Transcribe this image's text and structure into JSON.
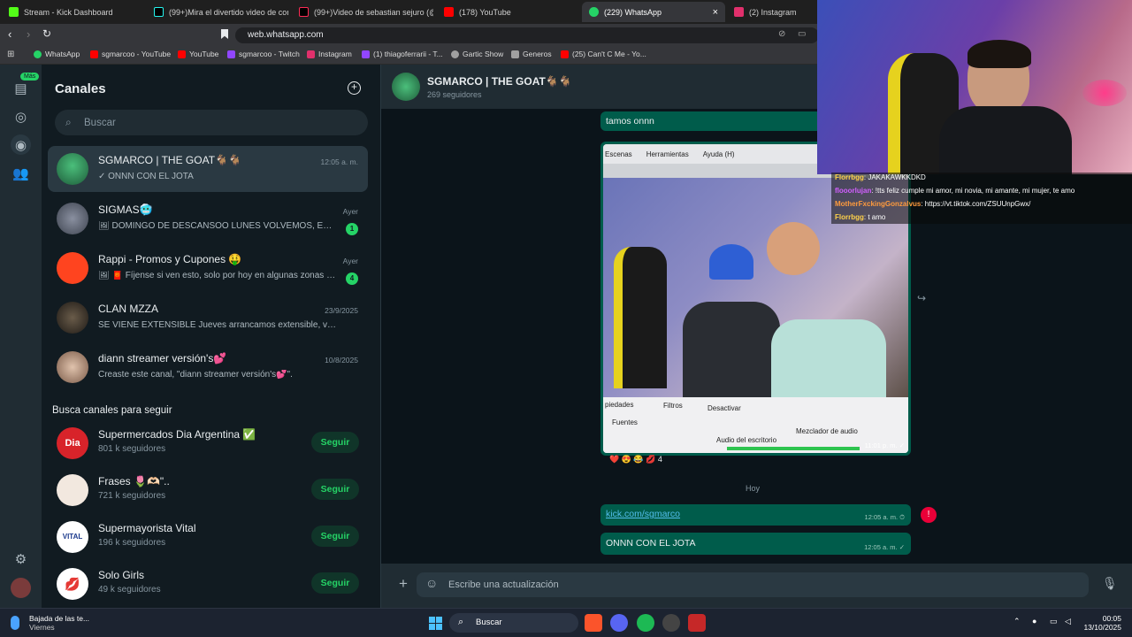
{
  "browser": {
    "tabs": [
      {
        "label": "Stream - Kick Dashboard",
        "icon": "kick-icon",
        "color": "#53fc18"
      },
      {
        "label": "(99+)Mira el divertido video de com",
        "icon": "tiktok-icon",
        "color": "#ffffff"
      },
      {
        "label": "(99+)Video de sebastian sejuro (@se",
        "icon": "tiktok-icon",
        "color": "#ffffff"
      },
      {
        "label": "(178) YouTube",
        "icon": "youtube-icon",
        "color": "#ff0000"
      },
      {
        "label": "(229) WhatsApp",
        "icon": "whatsapp-icon",
        "color": "#25d366"
      },
      {
        "label": "(2) Instagram",
        "icon": "instagram-icon",
        "color": "#e1306c"
      }
    ],
    "active_tab_close": "×",
    "url": "web.whatsapp.com",
    "bookmarks": [
      {
        "label": "WhatsApp",
        "color": "#25d366"
      },
      {
        "label": "sgmarcoo - YouTube",
        "color": "#ff0000"
      },
      {
        "label": "YouTube",
        "color": "#ff0000"
      },
      {
        "label": "sgmarcoo - Twitch",
        "color": "#9146ff"
      },
      {
        "label": "Instagram",
        "color": "#e1306c"
      },
      {
        "label": "(1) thiagoferrarii - T...",
        "color": "#9146ff"
      },
      {
        "label": "Gartic Show",
        "color": "#a0a0a0"
      },
      {
        "label": "Generos",
        "color": "#a0a0a0"
      },
      {
        "label": "(25) Can't C Me - Yo...",
        "color": "#ff0000"
      }
    ]
  },
  "rail": {
    "mas_badge": "Más",
    "icons": [
      "chats-icon",
      "status-icon",
      "channels-icon",
      "communities-icon",
      "settings-icon",
      "profile-avatar"
    ]
  },
  "sidebar": {
    "title": "Canales",
    "search_placeholder": "Buscar",
    "channels": [
      {
        "name": "SGMARCO | THE GOAT🐐🐐",
        "preview": "✓ ONNN CON EL JOTA",
        "time": "12:05 a. m.",
        "badge": "",
        "color": "#2e7d4f"
      },
      {
        "name": "SIGMAS🥶",
        "preview": "🖼 DOMINGO DE DESCANSOO LUNES VOLVEMOS, EMPIEZA LA SEMANA",
        "time": "Ayer",
        "badge": "1",
        "color": "#5a6270"
      },
      {
        "name": "Rappi - Promos y Cupones 🤑",
        "preview": "🖼 🧧 Fíjense si ven esto, solo por hoy en algunas zonas hay descuentos",
        "time": "Ayer",
        "badge": "4",
        "color": "#ff441f"
      },
      {
        "name": "CLAN MZZA",
        "preview": "SE VIENE EXTENSIBLE  Jueves arrancamos extensible, va a durar",
        "time": "23/9/2025",
        "badge": "",
        "color": "#3a3630"
      },
      {
        "name": "diann streamer versión's💕",
        "preview": "Creaste este canal, \"diann streamer versión's💕\".",
        "time": "10/8/2025",
        "badge": "",
        "color": "#c9a58c"
      }
    ],
    "discover_title": "Busca canales para seguir",
    "suggestions": [
      {
        "name": "Supermercados Dia Argentina ✅",
        "followers": "801 k seguidores",
        "button": "Seguir",
        "color": "#d8232a"
      },
      {
        "name": "Frases 🌷🫶🏻\"..",
        "followers": "721 k seguidores",
        "button": "Seguir",
        "color": "#f2e8df"
      },
      {
        "name": "Supermayorista Vital",
        "followers": "196 k seguidores",
        "button": "Seguir",
        "color": "#ffffff"
      },
      {
        "name": "Solo Girls",
        "followers": "49 k seguidores",
        "button": "Seguir",
        "color": "#ffffff"
      }
    ]
  },
  "chat": {
    "name": "SGMARCO | THE GOAT🐐🐐",
    "followers": "269 seguidores",
    "messages": [
      {
        "text": "tamos onnn",
        "time": ""
      },
      {
        "text": "",
        "time": "11:01 p. m. ✓"
      }
    ],
    "reactions": "❤️ 😍 😂 💋 4",
    "day_separator": "Hoy",
    "link_message": {
      "text": "kick.com/sgmarco",
      "time": "12:05 a. m. ⏱"
    },
    "last_message": {
      "text": "ONNN CON EL JOTA",
      "time": "12:05 a. m. ✓"
    },
    "composer_placeholder": "Escribe una actualización",
    "photo_ui": {
      "menu": [
        "Escenas",
        "Herramientas",
        "Ayuda (H)"
      ],
      "bottom": [
        "piedades",
        "Filtros",
        "Desactivar",
        "Fuentes",
        "Mezclador de audio",
        "Audio del escritorio"
      ]
    }
  },
  "stream_chat": [
    {
      "user": "Florrbgg",
      "msg": ": JAKAKAWKKDKD",
      "color": "#ffd24a"
    },
    {
      "user": "flooorlujan",
      "msg": ": !tts feliz cumple mi amor, mi novia, mi amante, mi mujer, te amo",
      "color": "#d25fff"
    },
    {
      "user": "MotherFxckingGonzalvus",
      "msg": ": https://vt.tiktok.com/ZSUUnpGwx/",
      "color": "#ff9b3d"
    },
    {
      "user": "Florrbgg",
      "msg": ": t amo",
      "color": "#ffd24a"
    }
  ],
  "taskbar": {
    "weather_title": "Bajada de las te...",
    "weather_sub": "Viernes",
    "search_label": "Buscar",
    "time": "00:05",
    "date": "13/10/2025"
  }
}
